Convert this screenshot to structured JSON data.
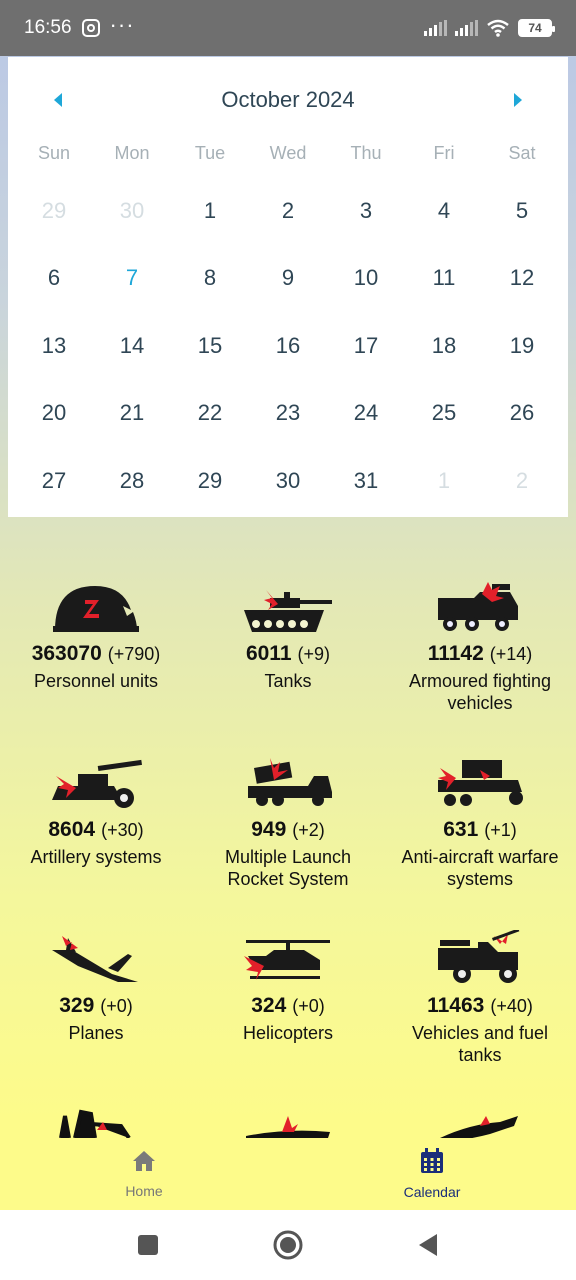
{
  "status_bar": {
    "time": "16:56",
    "dots": "···",
    "battery": "74"
  },
  "calendar": {
    "title": "October 2024",
    "weekdays": [
      "Sun",
      "Mon",
      "Tue",
      "Wed",
      "Thu",
      "Fri",
      "Sat"
    ],
    "days": [
      {
        "label": "29",
        "muted": true
      },
      {
        "label": "30",
        "muted": true
      },
      {
        "label": "1"
      },
      {
        "label": "2"
      },
      {
        "label": "3"
      },
      {
        "label": "4"
      },
      {
        "label": "5"
      },
      {
        "label": "6"
      },
      {
        "label": "7",
        "today": true
      },
      {
        "label": "8"
      },
      {
        "label": "9"
      },
      {
        "label": "10"
      },
      {
        "label": "11"
      },
      {
        "label": "12"
      },
      {
        "label": "13"
      },
      {
        "label": "14"
      },
      {
        "label": "15"
      },
      {
        "label": "16"
      },
      {
        "label": "17"
      },
      {
        "label": "18"
      },
      {
        "label": "19"
      },
      {
        "label": "20"
      },
      {
        "label": "21"
      },
      {
        "label": "22"
      },
      {
        "label": "23"
      },
      {
        "label": "24"
      },
      {
        "label": "25"
      },
      {
        "label": "26"
      },
      {
        "label": "27"
      },
      {
        "label": "28"
      },
      {
        "label": "29"
      },
      {
        "label": "30"
      },
      {
        "label": "31"
      },
      {
        "label": "1",
        "muted": true
      },
      {
        "label": "2",
        "muted": true
      }
    ]
  },
  "stats": [
    {
      "icon": "helmet-icon",
      "value": "363070",
      "delta": "(+790)",
      "label": "Personnel units"
    },
    {
      "icon": "tank-icon",
      "value": "6011",
      "delta": "(+9)",
      "label": "Tanks"
    },
    {
      "icon": "armoured-vehicle-icon",
      "value": "11142",
      "delta": "(+14)",
      "label": "Armoured fighting vehicles"
    },
    {
      "icon": "artillery-icon",
      "value": "8604",
      "delta": "(+30)",
      "label": "Artillery systems"
    },
    {
      "icon": "rocket-launcher-icon",
      "value": "949",
      "delta": "(+2)",
      "label": "Multiple Launch Rocket System"
    },
    {
      "icon": "anti-aircraft-icon",
      "value": "631",
      "delta": "(+1)",
      "label": "Anti-aircraft warfare systems"
    },
    {
      "icon": "plane-icon",
      "value": "329",
      "delta": "(+0)",
      "label": "Planes"
    },
    {
      "icon": "helicopter-icon",
      "value": "324",
      "delta": "(+0)",
      "label": "Helicopters"
    },
    {
      "icon": "fuel-truck-icon",
      "value": "11463",
      "delta": "(+40)",
      "label": "Vehicles and fuel tanks"
    }
  ],
  "bottom_nav": {
    "home_label": "Home",
    "calendar_label": "Calendar"
  },
  "colors": {
    "accent": "#1ea7d8",
    "nav_active": "#1a2d7a",
    "text_dark": "#2f4655",
    "red": "#e2202a"
  }
}
